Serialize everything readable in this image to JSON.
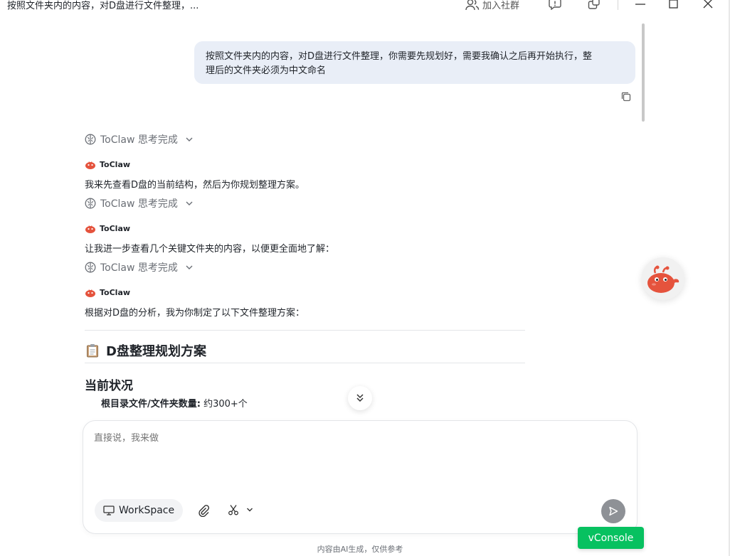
{
  "window": {
    "title": "按照文件夹内的内容，对D盘进行文件整理，...",
    "join_community": "加入社群"
  },
  "user_message": {
    "line1": "按照文件夹内的内容，对D盘进行文件整理，你需要先规划好，需要我确认之后再开始执行，整",
    "line2": "理后的文件夹必须为中文命名"
  },
  "thinking_label": "ToClaw 思考完成",
  "agent_name": "ToClaw",
  "messages": [
    "我来先查看D盘的当前结构，然后为你规划整理方案。",
    "让我进一步查看几个关键文件夹的内容，以便更全面地了解：",
    "根据对D盘的分析，我为你制定了以下文件整理方案："
  ],
  "plan": {
    "title": "D盘整理规划方案",
    "section": "当前状况",
    "bullet_label": "根目录文件/文件夹数量:",
    "bullet_value": "约300+个"
  },
  "composer": {
    "placeholder": "直接说，我来做",
    "workspace_label": "WorkSpace"
  },
  "vconsole_label": "vConsole",
  "footer_note": "内容由AI生成，仅供参考",
  "colors": {
    "bubble": "#e9eef7",
    "vconsole": "#07c160",
    "send_button": "#8e9196",
    "mascot": "#e5533d"
  },
  "icons": [
    "people-icon",
    "feedback-icon",
    "share-icon",
    "minimize-icon",
    "maximize-icon",
    "close-icon",
    "copy-icon",
    "brain-icon",
    "chevron-down-icon",
    "mascot-icon",
    "clipboard-icon",
    "double-chevron-down-icon",
    "monitor-icon",
    "paperclip-icon",
    "scissors-icon",
    "send-icon"
  ]
}
